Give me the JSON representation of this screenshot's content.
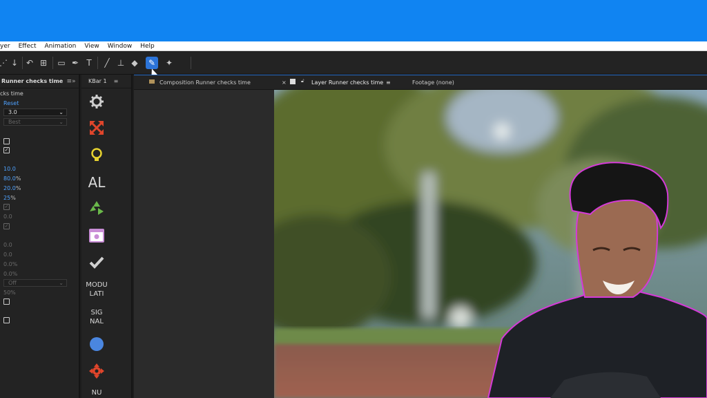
{
  "menu": [
    "yer",
    "Effect",
    "Animation",
    "View",
    "Window",
    "Help"
  ],
  "effect_controls": {
    "tab_title": "Runner checks time",
    "subtitle": "cks time",
    "reset_label": "Reset",
    "dropdown1_value": "3.0",
    "dropdown2_value": "Best",
    "values": [
      "10.0",
      "80.0",
      "20.0",
      "25"
    ],
    "percent": "%",
    "dim_values": [
      "0.0",
      "0.0",
      "0.0",
      "0.0%",
      "0.0%"
    ],
    "dropdown3_value": "Off",
    "dim_pct": "50%"
  },
  "kbar": {
    "title": "KBar 1",
    "al_label": "AL",
    "modu_label": "MODU\nLATI",
    "signal_label": "SIG\nNAL",
    "nu_label": "NU"
  },
  "viewer": {
    "composition_tab": "Composition",
    "composition_name": "Runner checks time",
    "layer_tab": "Layer Runner checks time",
    "footage_tab": "Footage (none)"
  }
}
